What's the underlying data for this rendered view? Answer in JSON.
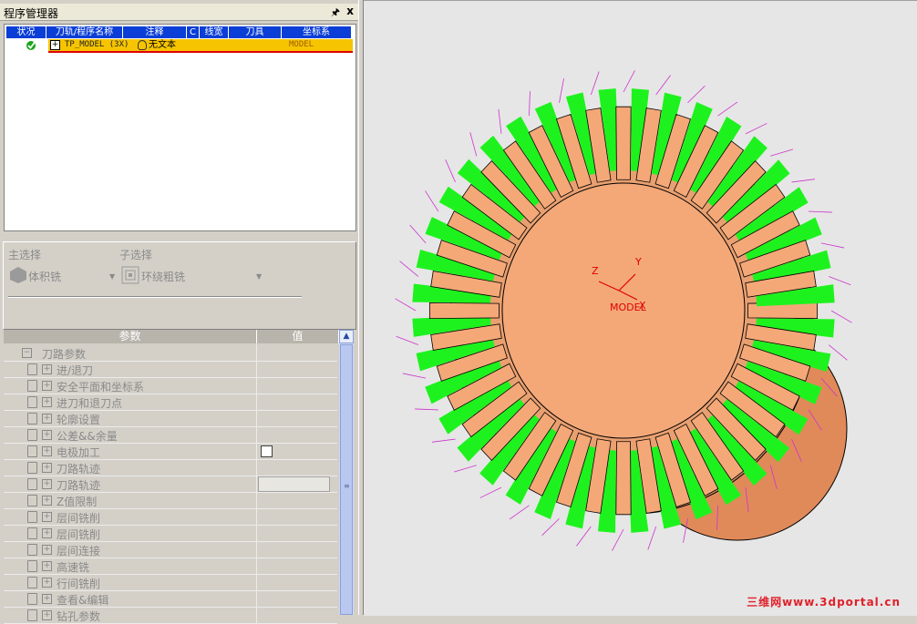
{
  "program_manager": {
    "title": "程序管理器",
    "pin_icon": "pin-icon",
    "close_glyph": "x",
    "columns": [
      "状况",
      "刀轨/程序名称",
      "注释",
      "C",
      "线宽",
      "刀具",
      "坐标系"
    ],
    "row": {
      "expand": "+",
      "name": "TP_MODEL (3X)",
      "note": "无文本",
      "coord": "MODEL"
    }
  },
  "selection": {
    "main_label": "主选择",
    "main_value": "体积铣",
    "sub_label": "子选择",
    "sub_value": "环绕粗铣"
  },
  "params": {
    "col_param": "参数",
    "col_value": "值",
    "rows": [
      {
        "label": "刀路参数",
        "type": "group"
      },
      {
        "label": "进/退刀",
        "type": "item"
      },
      {
        "label": "安全平面和坐标系",
        "type": "item"
      },
      {
        "label": "进刀和退刀点",
        "type": "item"
      },
      {
        "label": "轮廓设置",
        "type": "item"
      },
      {
        "label": "公差&&余量",
        "type": "item"
      },
      {
        "label": "电极加工",
        "type": "checkbox"
      },
      {
        "label": "刀路轨迹",
        "type": "item"
      },
      {
        "label": "刀路轨迹",
        "type": "button"
      },
      {
        "label": "Z值限制",
        "type": "item"
      },
      {
        "label": "层间铣削",
        "type": "item"
      },
      {
        "label": "层间铣削",
        "type": "item"
      },
      {
        "label": "层间连接",
        "type": "item"
      },
      {
        "label": "高速铣",
        "type": "item"
      },
      {
        "label": "行间铣削",
        "type": "item"
      },
      {
        "label": "查看&编辑",
        "type": "item"
      },
      {
        "label": "钻孔参数",
        "type": "item"
      }
    ]
  },
  "viewport": {
    "axis_x": "X",
    "axis_y": "Y",
    "axis_z": "Z",
    "model_label": "MODEL",
    "watermark": "三维网www.3dportal.cn"
  },
  "colors": {
    "toolpath_green": "#1ef21e",
    "gear_body": "#f4a878",
    "gear_side": "#e08a5a",
    "selection_blue": "#0a3ed6",
    "row_yellow": "#f6c400"
  }
}
